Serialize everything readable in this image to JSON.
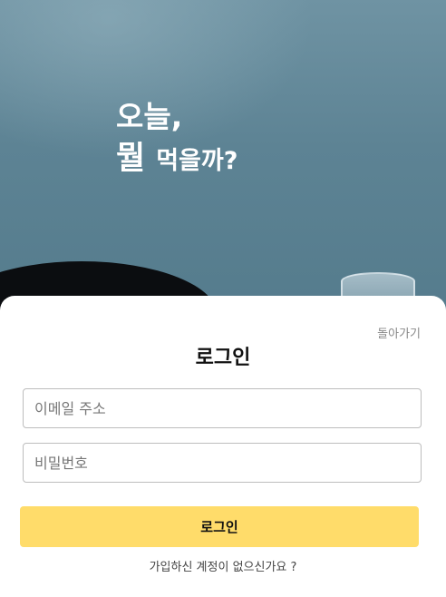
{
  "hero": {
    "headline_line1": "오늘,",
    "headline_line2_big": "뭘",
    "headline_line2_small": "먹을까?"
  },
  "login": {
    "back_label": "돌아가기",
    "title": "로그인",
    "email_placeholder": "이메일 주소",
    "password_placeholder": "비밀번호",
    "submit_label": "로그인",
    "signup_prompt": "가입하신 계정이 없으신가요 ?"
  },
  "colors": {
    "accent": "#ffdc6a",
    "hero_bg": "#5f8596"
  }
}
